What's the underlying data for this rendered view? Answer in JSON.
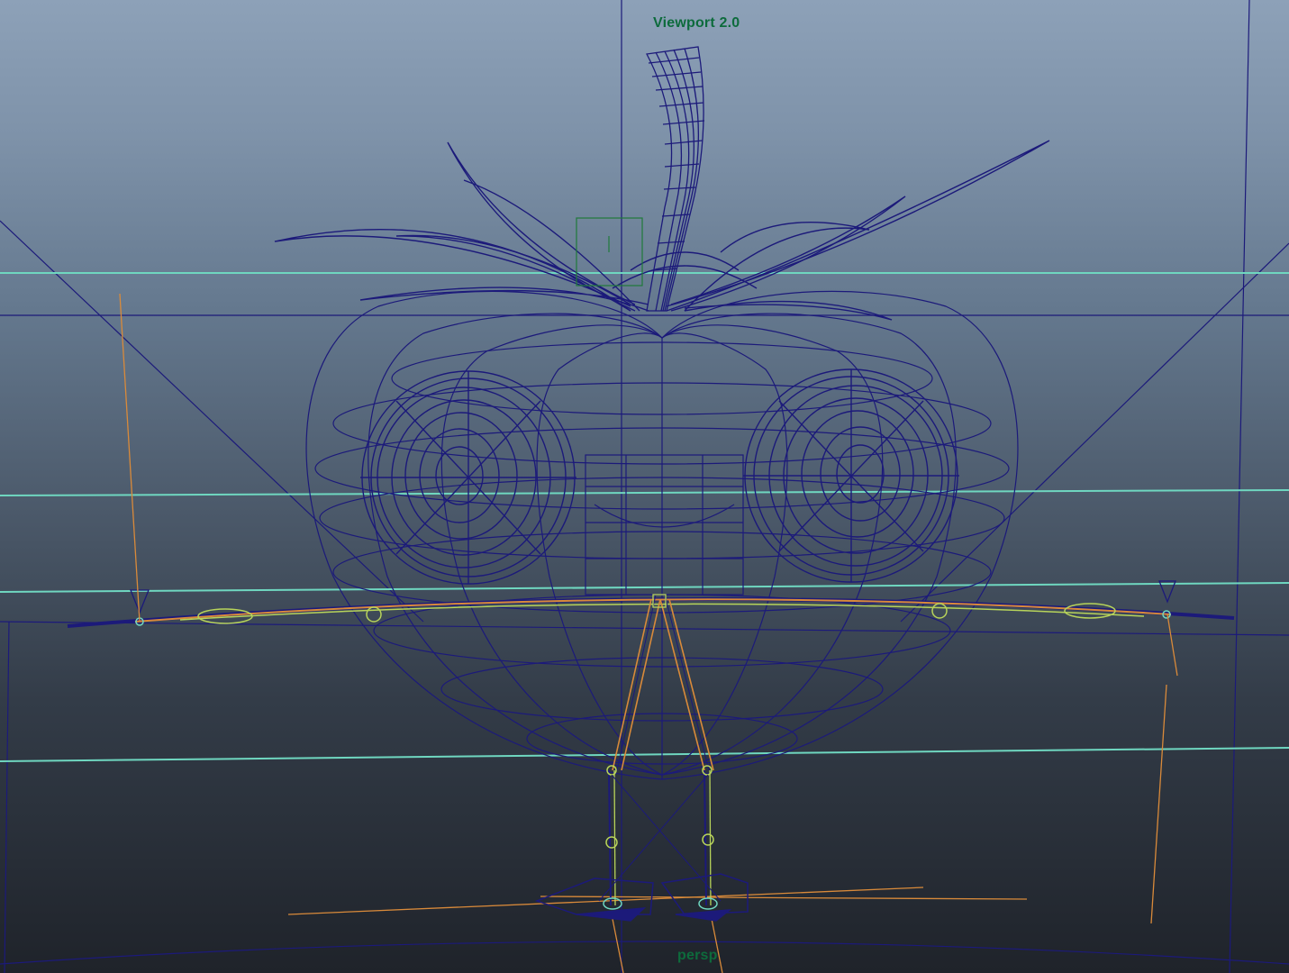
{
  "viewport": {
    "renderer_label": "Viewport 2.0",
    "camera_label": "persp"
  },
  "colors": {
    "wireframe": "#1c1a7a",
    "grid_lines": "#6fd7c0",
    "joint_curves": "#d98a3a",
    "controls": "#b8d45a",
    "hud_text": "#0d6b3c",
    "selection_box": "#1f7a3a"
  },
  "scene": {
    "object": "tomato character rig",
    "elements": [
      "stem",
      "leaves",
      "body-mesh",
      "left-eye",
      "right-eye",
      "mouth-box",
      "arm-rig-curve",
      "left-leg",
      "right-leg",
      "foot-controls"
    ]
  }
}
